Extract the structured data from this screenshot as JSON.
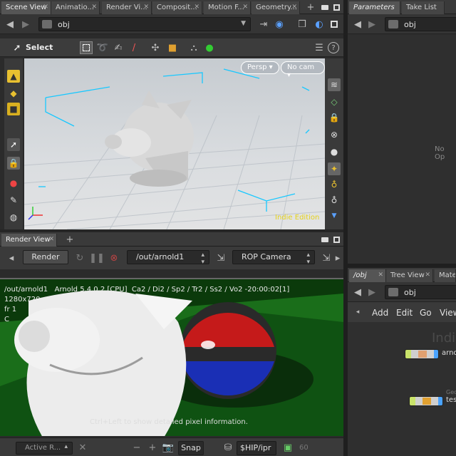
{
  "left_tabs": [
    {
      "label": "Scene View",
      "active": true
    },
    {
      "label": "Animatio..."
    },
    {
      "label": "Render Vi..."
    },
    {
      "label": "Composit..."
    },
    {
      "label": "Motion F..."
    },
    {
      "label": "Geometry..."
    }
  ],
  "scene_path": "obj",
  "toolbar": {
    "select_label": "Select"
  },
  "viewport": {
    "persp_label": "Persp ▾",
    "cam_label": "No cam ▾",
    "watermark": "Indie Edition"
  },
  "render_view": {
    "tab_label": "Render View",
    "render_button": "Render",
    "rop_path": "/out/arnold1",
    "camera": "ROP Camera",
    "info_line": "/out/arnold1   Arnold 5.4.0.2 [CPU]  Ca2 / Di2 / Sp2 / Tr2 / Ss2 / Vo2 -20:00:02[1]",
    "resolution": "1280x720",
    "frame": "fr 1",
    "channel": "C",
    "hint": "Ctrl+Left to show detailed pixel information."
  },
  "bottom_bar": {
    "active_label": "Active R...",
    "snap_label": "Snap",
    "hip_path": "$HIP/ipr",
    "frame_value": "60"
  },
  "right_top": {
    "tabs": [
      {
        "label": "Parameters",
        "active": true
      },
      {
        "label": "Take List"
      }
    ],
    "path": "obj",
    "empty_text": "No Op"
  },
  "right_bottom": {
    "tabs": [
      {
        "label": "/obj",
        "active": true
      },
      {
        "label": "Tree View"
      },
      {
        "label": "Mater"
      }
    ],
    "path": "obj",
    "menu": [
      "Add",
      "Edit",
      "Go",
      "View"
    ],
    "watermark": "Indi",
    "nodes": [
      {
        "label": "arnol"
      },
      {
        "label": "tes",
        "sublabel": "Geo"
      }
    ]
  },
  "colors": {
    "accent_cyan": "#18c8ff",
    "node_yellow": "#c9e36a",
    "node_blue": "#4aa3ff",
    "watermark_yellow": "#e6d21a"
  }
}
